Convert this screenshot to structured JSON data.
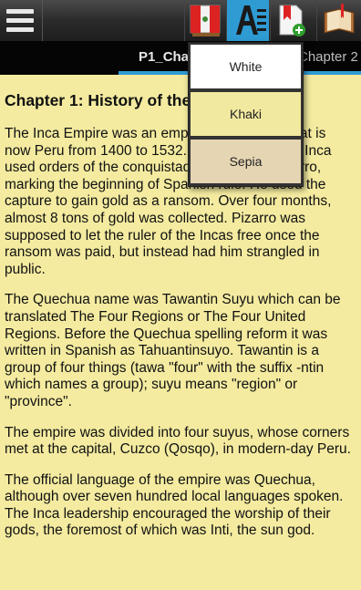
{
  "toolbar": {
    "menu_icon": "hamburger-menu-icon",
    "flag_icon": "peru-flag-book-icon",
    "font_icon": "font-style-icon",
    "bookmark_icon": "bookmark-add-icon",
    "book_icon": "open-book-icon",
    "font_accent": "#2f9bd3"
  },
  "tabs": [
    {
      "label": "P1_Chap"
    },
    {
      "label": "Chapter 2"
    }
  ],
  "content": {
    "title": "Chapter 1: History of the",
    "paragraphs": [
      "The Inca Empire was an empire centered in what is now Peru from 1400 to 1532. In that period, the Inca used orders of the conquistador Francisco Pizarro, marking the beginning of Spanish rule. He used the capture to gain gold as a ransom. Over four months, almost 8 tons of gold was collected. Pizarro was supposed to let the ruler of the Incas free once the ransom was paid, but instead had him strangled in public.",
      "The Quechua name was Tawantin Suyu which can be translated The Four Regions or The Four United Regions. Before the Quechua spelling reform it was written in Spanish as Tahuantinsuyo. Tawantin is a group of four things (tawa \"four\" with the suffix -ntin which names a group); suyu means \"region\" or \"province\".",
      "The empire was divided into four suyus, whose corners met at the capital, Cuzco (Qosqo), in modern-day Peru.",
      "The official language of the empire was Quechua, although over seven hundred local languages spoken. The Inca leadership encouraged the worship of their gods, the foremost of which was Inti, the sun god."
    ]
  },
  "theme_menu": {
    "options": [
      {
        "label": "White",
        "color": "#ffffff"
      },
      {
        "label": "Khaki",
        "color": "#f2e9a0"
      },
      {
        "label": "Sepia",
        "color": "#e6d5b3"
      }
    ]
  }
}
